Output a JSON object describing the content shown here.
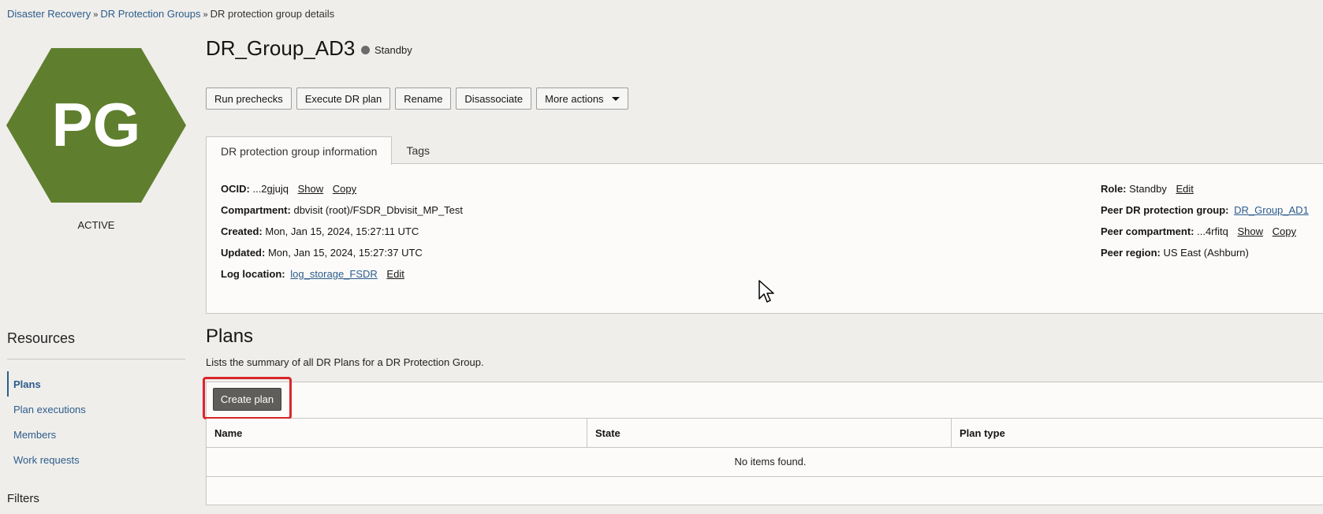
{
  "breadcrumb": {
    "items": [
      "Disaster Recovery",
      "DR Protection Groups"
    ],
    "current": "DR protection group details",
    "separator": "»"
  },
  "logo": {
    "initials": "PG",
    "color": "#5f7f2e",
    "state": "ACTIVE"
  },
  "header": {
    "title": "DR_Group_AD3",
    "status": "Standby"
  },
  "actions": {
    "run_prechecks": "Run prechecks",
    "execute_dr_plan": "Execute DR plan",
    "rename": "Rename",
    "disassociate": "Disassociate",
    "more_actions": "More actions"
  },
  "tabs": [
    "DR protection group information",
    "Tags"
  ],
  "info": {
    "ocid_label": "OCID:",
    "ocid_value": "...2gjujq",
    "show": "Show",
    "copy": "Copy",
    "compartment_label": "Compartment:",
    "compartment_value": "dbvisit (root)/FSDR_Dbvisit_MP_Test",
    "created_label": "Created:",
    "created_value": "Mon, Jan 15, 2024, 15:27:11 UTC",
    "updated_label": "Updated:",
    "updated_value": "Mon, Jan 15, 2024, 15:27:37 UTC",
    "log_label": "Log location:",
    "log_value": "log_storage_FSDR",
    "edit": "Edit",
    "role_label": "Role:",
    "role_value": "Standby",
    "peer_group_label": "Peer DR protection group:",
    "peer_group_value": "DR_Group_AD1",
    "peer_comp_label": "Peer compartment:",
    "peer_comp_value": "...4rfitq",
    "peer_region_label": "Peer region:",
    "peer_region_value": "US East (Ashburn)"
  },
  "resources": {
    "title": "Resources",
    "items": [
      "Plans",
      "Plan executions",
      "Members",
      "Work requests"
    ],
    "filters": "Filters"
  },
  "plans": {
    "title": "Plans",
    "description": "Lists the summary of all DR Plans for a DR Protection Group.",
    "create": "Create plan",
    "columns": [
      "Name",
      "State",
      "Plan type"
    ],
    "empty": "No items found."
  }
}
